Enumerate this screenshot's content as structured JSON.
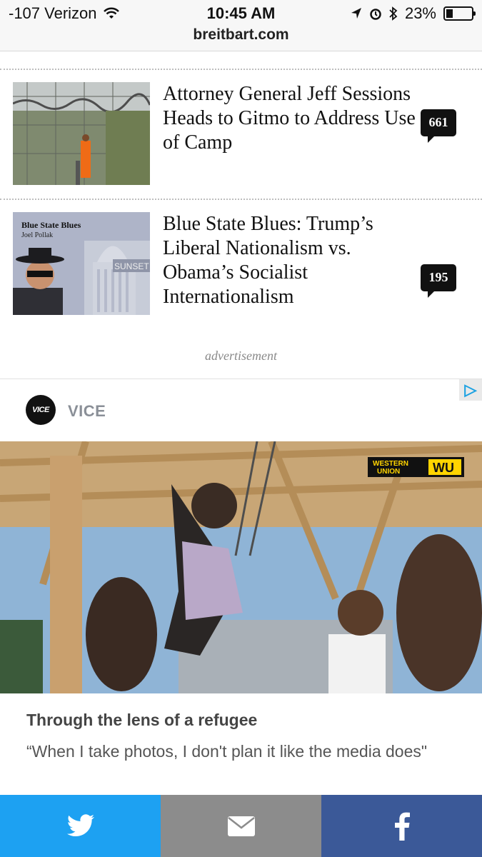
{
  "status_bar": {
    "carrier": "-107 Verizon",
    "time": "10:45 AM",
    "battery": "23%",
    "url": "breitbart.com"
  },
  "articles": [
    {
      "headline": "Attorney General Jeff Sessions Heads to Gitmo to Address Use of Camp",
      "comments": "661"
    },
    {
      "headline": "Blue State Blues: Trump’s Liberal Nationalism vs. Obama’s Socialist Internationalism",
      "comments": "195",
      "thumb_title": "Blue State Blues",
      "thumb_author": "Joel Pollak",
      "thumb_sign": "SUNSET"
    }
  ],
  "ad": {
    "label": "advertisement",
    "sponsor": "VICE",
    "logo_text": "VICE",
    "photo_brand_line1": "WESTERN",
    "photo_brand_line2": "UNION",
    "photo_brand_mark": "WU",
    "title": "Through the lens of a refugee",
    "subtitle": "“When I take photos, I don't plan it like the media does\""
  },
  "share_bar": {
    "buttons": [
      "twitter",
      "email",
      "facebook"
    ],
    "colors": {
      "twitter": "#1da1f2",
      "email": "#8c8c8c",
      "facebook": "#3b5998"
    }
  }
}
